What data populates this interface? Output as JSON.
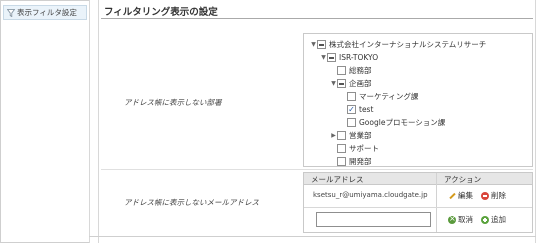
{
  "nav": {
    "item_label": "表示フィルタ設定",
    "icon": "filter-icon"
  },
  "section": {
    "title": "フィルタリング表示の設定"
  },
  "rows": {
    "hidden_departments_label": "アドレス帳に表示しない部署",
    "hidden_addresses_label": "アドレス帳に表示しないメールアドレス"
  },
  "tree": [
    {
      "label": "株式会社インターナショナルシステムリサーチ",
      "arrow": "▼",
      "state": "partial"
    },
    {
      "label": "ISR-TOKYO",
      "arrow": "▼",
      "state": "partial"
    },
    {
      "label": "総務部",
      "arrow": "",
      "state": "unchecked"
    },
    {
      "label": "企画部",
      "arrow": "▼",
      "state": "partial"
    },
    {
      "label": "マーケティング課",
      "arrow": "",
      "state": "unchecked"
    },
    {
      "label": "test",
      "arrow": "",
      "state": "checked"
    },
    {
      "label": "Googleプロモーション課",
      "arrow": "",
      "state": "unchecked"
    },
    {
      "label": "営業部",
      "arrow": "▶",
      "state": "unchecked"
    },
    {
      "label": "サポート",
      "arrow": "",
      "state": "unchecked"
    },
    {
      "label": "開発部",
      "arrow": "",
      "state": "unchecked"
    }
  ],
  "address_table": {
    "col_email": "メールアドレス",
    "col_action": "アクション",
    "email": "ksetsu_r@umiyama.cloudgate.jp",
    "edit_label": "編集",
    "delete_label": "削除",
    "cancel_label": "取消",
    "add_label": "追加",
    "input_value": ""
  }
}
